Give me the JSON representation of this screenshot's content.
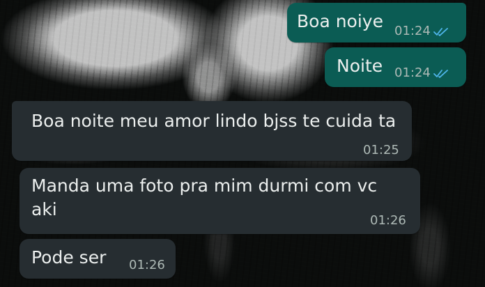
{
  "messages": [
    {
      "direction": "outgoing",
      "text": "Boa noiye",
      "time": "01:24",
      "status_icon": "double-check-read-icon",
      "read_color": "#4fb6ec"
    },
    {
      "direction": "outgoing",
      "text": "Noite",
      "time": "01:24",
      "status_icon": "double-check-read-icon",
      "read_color": "#4fb6ec"
    },
    {
      "direction": "incoming",
      "text": "Boa noite meu amor lindo bjss te cuida ta",
      "time": "01:25"
    },
    {
      "direction": "incoming",
      "text": "Manda uma foto pra mim durmi com vc aki",
      "time": "01:26"
    },
    {
      "direction": "incoming",
      "text": "Pode ser",
      "time": "01:26"
    }
  ],
  "colors": {
    "outgoing_bubble": "#0b5c54",
    "incoming_bubble": "#262d31",
    "message_text": "#ecefee",
    "timestamp": "#aebab6",
    "read_receipt": "#4fb6ec"
  }
}
